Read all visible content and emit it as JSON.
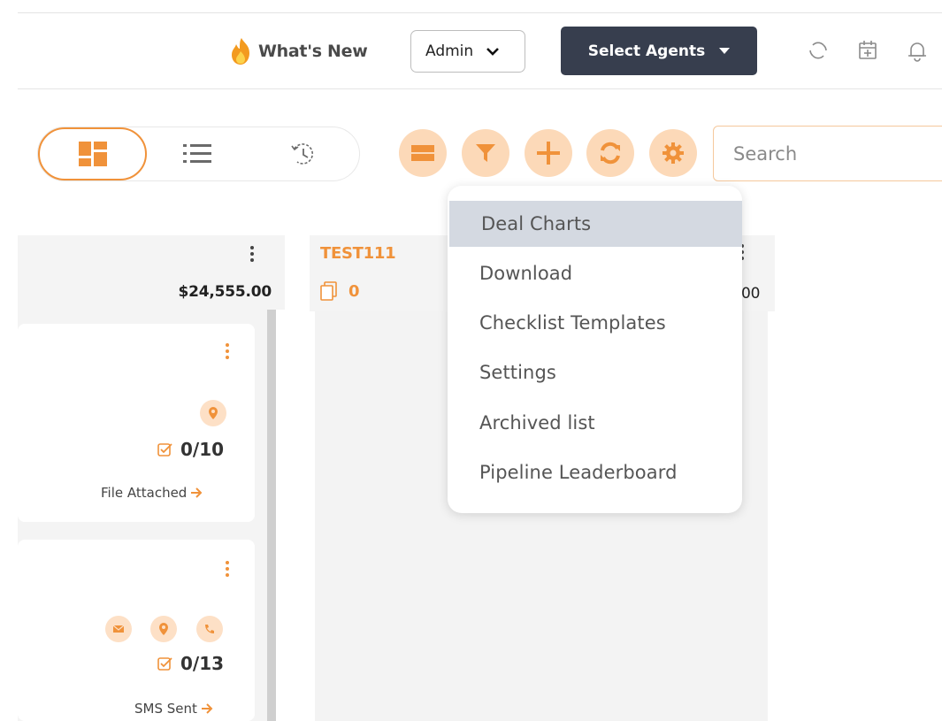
{
  "header": {
    "whats_new_label": "What's New",
    "role_select_value": "Admin",
    "select_agents_label": "Select Agents"
  },
  "toolbar": {
    "search_placeholder": "Search"
  },
  "board": {
    "columns": [
      {
        "amount": "$24,555.00"
      },
      {
        "title": "TEST111",
        "count": "0",
        "amount_partial": "00"
      }
    ],
    "cards": [
      {
        "tasks": "0/10",
        "status": "File Attached"
      },
      {
        "tasks": "0/13",
        "status": "SMS Sent"
      }
    ]
  },
  "dropdown": {
    "items": [
      {
        "label": "Deal Charts"
      },
      {
        "label": "Download"
      },
      {
        "label": "Checklist Templates"
      },
      {
        "label": "Settings"
      },
      {
        "label": "Archived list"
      },
      {
        "label": "Pipeline Leaderboard"
      }
    ]
  },
  "colors": {
    "accent": "#f0923a",
    "accent_light": "#fcd9b8",
    "dark_button": "#373e4e",
    "menu_hover": "#d4d9e1"
  }
}
